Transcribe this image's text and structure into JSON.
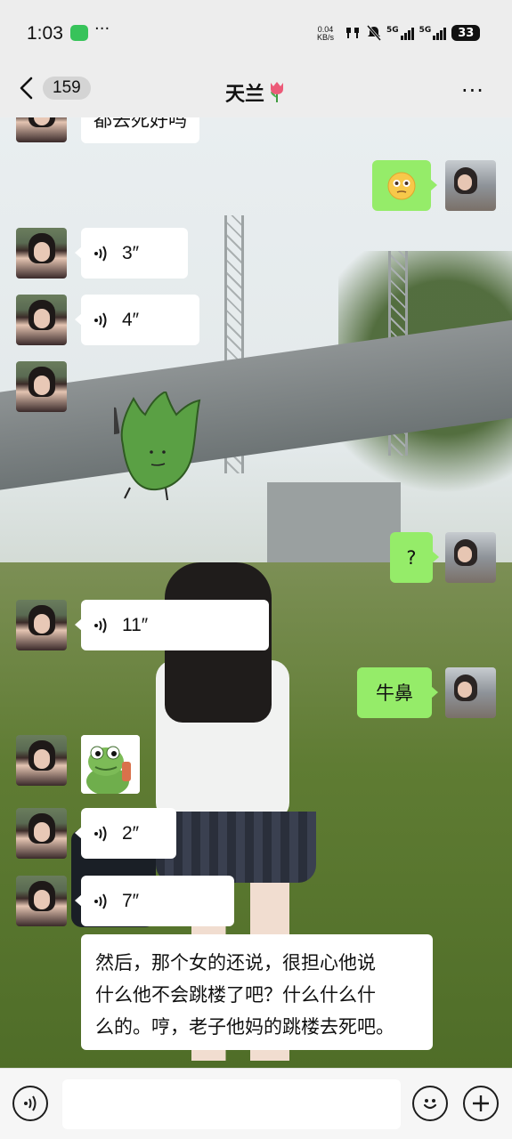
{
  "status_bar": {
    "time": "1:03",
    "more": "···",
    "net_speed_value": "0.04",
    "net_speed_unit": "KB/s",
    "sim1_label": "5G",
    "sim2_label": "5G",
    "battery": "33"
  },
  "header": {
    "back_badge": "159",
    "title": "天兰",
    "title_emoji": "tulip-icon",
    "more": "···"
  },
  "messages": [
    {
      "side": "in",
      "type": "text",
      "text": "都去死好吗"
    },
    {
      "side": "out",
      "type": "emoji",
      "emoji": "😳"
    },
    {
      "side": "in",
      "type": "voice",
      "duration": "3″"
    },
    {
      "side": "in",
      "type": "voice",
      "duration": "4″"
    },
    {
      "side": "in",
      "type": "sticker",
      "sticker": "leaf-character-sticker"
    },
    {
      "side": "out",
      "type": "text",
      "text": "?"
    },
    {
      "side": "in",
      "type": "voice",
      "duration": "11″"
    },
    {
      "side": "out",
      "type": "text",
      "text": "牛鼻"
    },
    {
      "side": "in",
      "type": "sticker",
      "sticker": "frog-sticker"
    },
    {
      "side": "in",
      "type": "voice",
      "duration": "2″"
    },
    {
      "side": "in",
      "type": "voice",
      "duration": "7″"
    },
    {
      "side": "in",
      "type": "voice-transcript",
      "lines": [
        "然后，那个女的还说，很担心他说",
        "什么他不会跳楼了吧？什么什么什",
        "么的。哼，老子他妈的跳楼去死吧。"
      ]
    }
  ],
  "input_bar": {
    "voice_button": "voice-icon",
    "input_value": "",
    "emoji_button": "smile-icon",
    "plus_button": "plus-icon"
  },
  "colors": {
    "bubble_in": "#ffffff",
    "bubble_out": "#95ec69",
    "header_bg": "#ededed",
    "input_bg": "#f6f6f6"
  }
}
